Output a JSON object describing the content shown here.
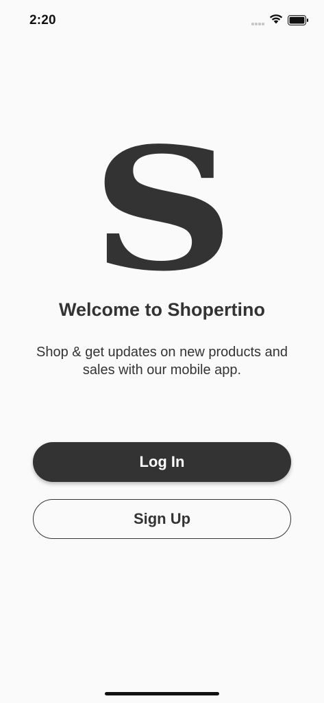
{
  "status_bar": {
    "time": "2:20",
    "icons": [
      "signal-icon",
      "wifi-icon",
      "battery-icon"
    ]
  },
  "logo": {
    "letter": "S"
  },
  "welcome": {
    "title": "Welcome to Shopertino",
    "subtitle": "Shop & get updates on new products and sales with our mobile app."
  },
  "actions": {
    "login_label": "Log In",
    "signup_label": "Sign Up"
  },
  "colors": {
    "background": "#fafafa",
    "primary": "#333333",
    "on_primary": "#ffffff"
  }
}
